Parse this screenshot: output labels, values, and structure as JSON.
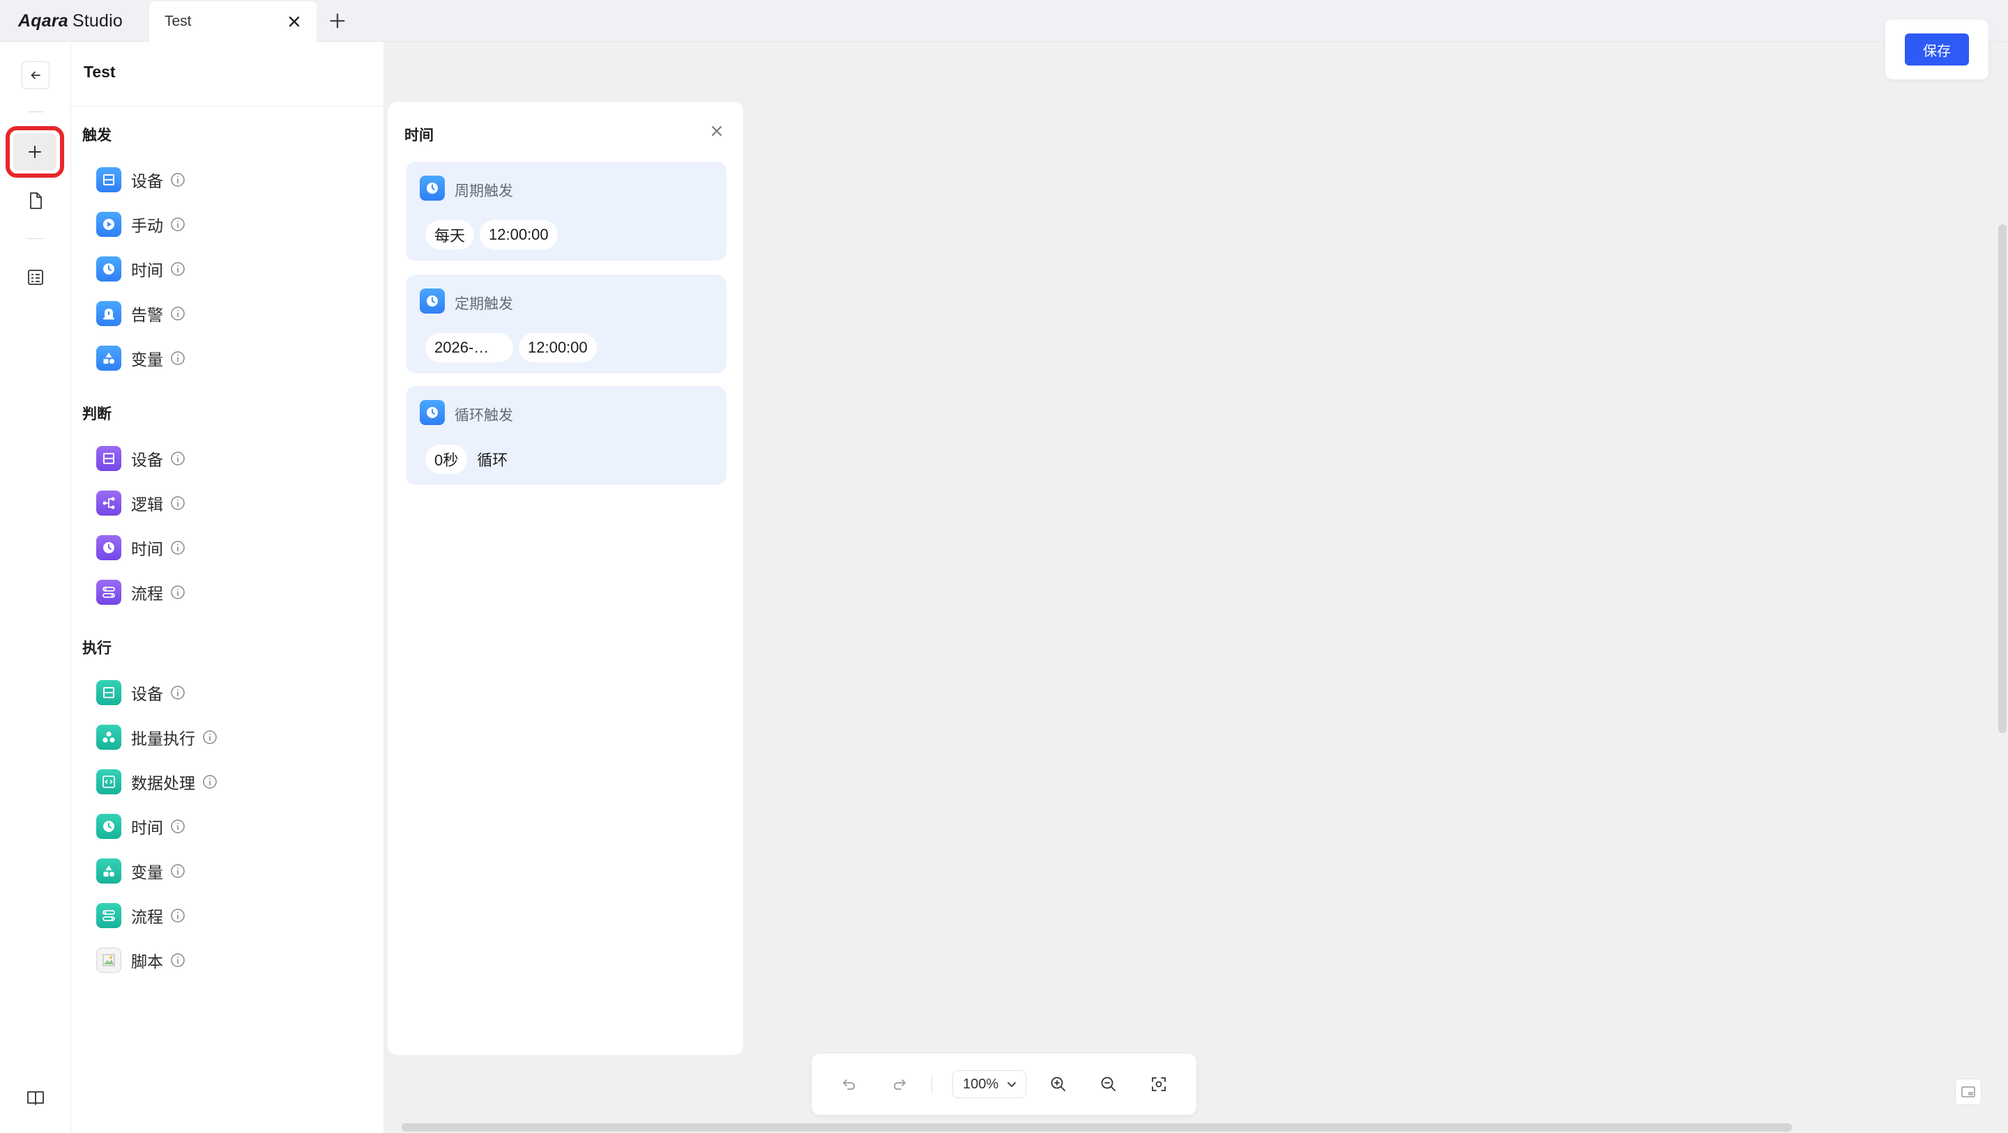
{
  "app": {
    "logo_brand": "Aqara",
    "logo_product": "Studio"
  },
  "tabs": [
    {
      "label": "Test"
    }
  ],
  "rail": {
    "icons": [
      "back-arrow-icon",
      "plus-icon",
      "document-icon",
      "table-icon",
      "book-icon"
    ]
  },
  "node_panel": {
    "title": "Test",
    "sections": [
      {
        "title": "触发",
        "items": [
          {
            "label": "设备",
            "icon": "device-icon",
            "color": "#3b8ff8"
          },
          {
            "label": "手动",
            "icon": "play-icon",
            "color": "#3b8ff8"
          },
          {
            "label": "时间",
            "icon": "clock-icon",
            "color": "#3b8ff8"
          },
          {
            "label": "告警",
            "icon": "alarm-icon",
            "color": "#3b8ff8"
          },
          {
            "label": "变量",
            "icon": "shapes-icon",
            "color": "#3b8ff8"
          }
        ]
      },
      {
        "title": "判断",
        "items": [
          {
            "label": "设备",
            "icon": "device-icon",
            "color": "#8459ee"
          },
          {
            "label": "逻辑",
            "icon": "branch-icon",
            "color": "#8459ee"
          },
          {
            "label": "时间",
            "icon": "clock-icon",
            "color": "#8459ee"
          },
          {
            "label": "流程",
            "icon": "flow-icon",
            "color": "#8459ee"
          }
        ]
      },
      {
        "title": "执行",
        "items": [
          {
            "label": "设备",
            "icon": "device-icon",
            "color": "#22c3a8"
          },
          {
            "label": "批量执行",
            "icon": "batch-icon",
            "color": "#22c3a8"
          },
          {
            "label": "数据处理",
            "icon": "code-icon",
            "color": "#22c3a8"
          },
          {
            "label": "时间",
            "icon": "clock-icon",
            "color": "#22c3a8"
          },
          {
            "label": "变量",
            "icon": "shapes-icon",
            "color": "#22c3a8"
          },
          {
            "label": "流程",
            "icon": "flow-icon",
            "color": "#22c3a8"
          },
          {
            "label": "脚本",
            "icon": "broken-image-icon",
            "color": "#f4f4f4"
          }
        ]
      }
    ]
  },
  "time_panel": {
    "title": "时间",
    "cards": [
      {
        "title": "周期触发",
        "pills": [
          "每天",
          "12:00:00"
        ]
      },
      {
        "title": "定期触发",
        "pills": [
          "2026-…",
          "12:00:00"
        ]
      },
      {
        "title": "循环触发",
        "pill": "0秒",
        "suffix": "循环"
      }
    ]
  },
  "save_label": "保存",
  "toolbar": {
    "zoom": "100%"
  },
  "colors": {
    "accent": "#2e5bf5",
    "highlight": "#e8262b"
  }
}
